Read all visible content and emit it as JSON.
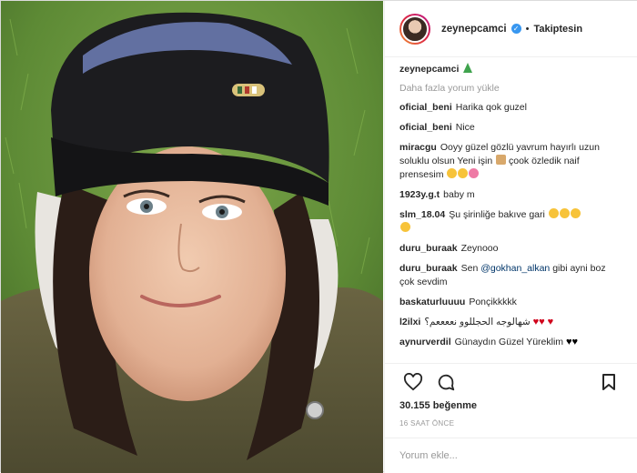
{
  "post": {
    "username": "zeynepcamci",
    "follow_status": "Takiptesin",
    "caption_username": "zeynepcamci",
    "load_more": "Daha fazla yorum yükle",
    "likes": "30.155 beğenme",
    "timestamp": "16 SAAT ÖNCE",
    "comment_placeholder": "Yorum ekle..."
  },
  "comments": [
    {
      "user": "oficial_beni",
      "text": "Harika qok guzel"
    },
    {
      "user": "oficial_beni",
      "text": "Nice"
    },
    {
      "user": "miracgu",
      "text": "Ooyy güzel gözlü yavrum hayırlı uzun soluklu olsun Yeni işin",
      "text2": "çook özledik naif prensesim"
    },
    {
      "user": "1923y.g.t",
      "text": "baby m"
    },
    {
      "user": "slm_18.04",
      "text": "Şu şirinliğe bakıve gari"
    },
    {
      "user": "duru_buraak",
      "text": "Zeynooo"
    },
    {
      "user": "duru_buraak",
      "text": "Sen",
      "mention": "@gokhan_alkan",
      "text2": "gibi ayni boz çok sevdim"
    },
    {
      "user": "baskaturluuuu",
      "text": "Ponçikkkkk"
    },
    {
      "user": "l2ilxi",
      "text": "شهالوجه الحجللوو نععععم؟"
    },
    {
      "user": "aynurverdil",
      "text": "Günaydın Güzel Yüreklim"
    }
  ],
  "icons": {
    "like": "heart-outline-icon",
    "comment": "speech-bubble-icon",
    "save": "bookmark-icon",
    "verified": "verified-badge-icon"
  },
  "colors": {
    "verified": "#3897f0",
    "muted": "#999999",
    "text": "#262626"
  }
}
